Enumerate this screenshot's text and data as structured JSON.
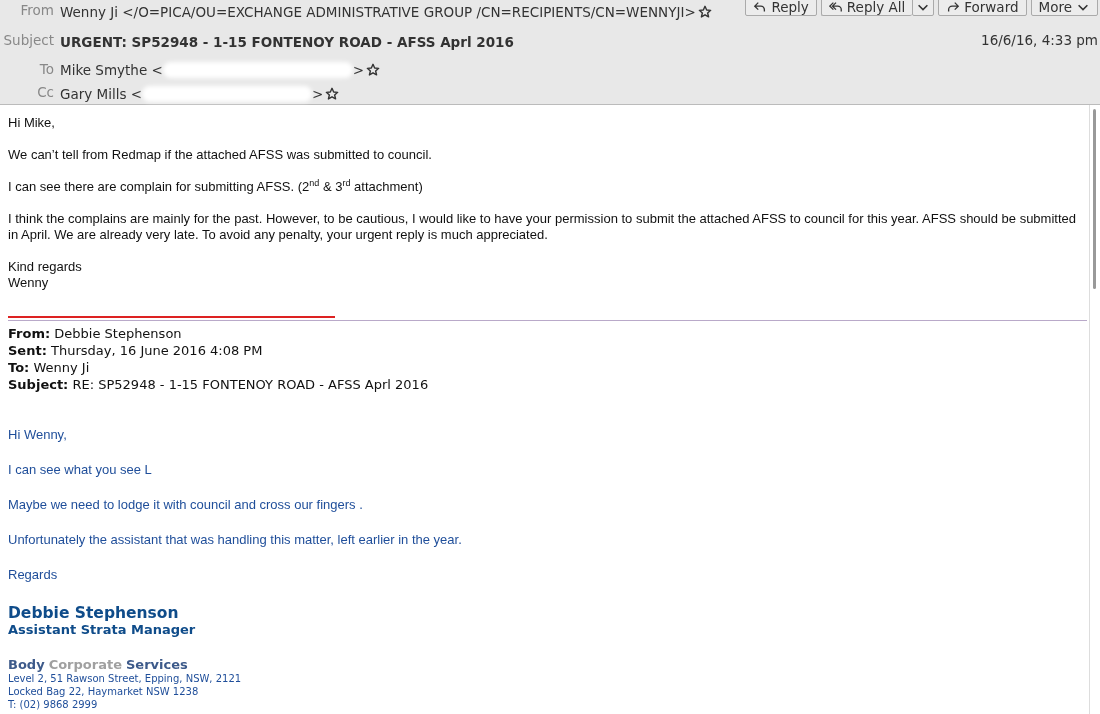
{
  "header": {
    "from": {
      "label": "From",
      "value": "Wenny Ji </O=PICA/OU=EXCHANGE ADMINISTRATIVE GROUP /CN=RECIPIENTS/CN=WENNYJI>",
      "starred": false
    },
    "subject": {
      "label": "Subject",
      "value": "URGENT: SP52948 - 1-15 FONTENOY ROAD - AFSS Aprl 2016"
    },
    "date": "16/6/16, 4:33 pm",
    "recipients": [
      {
        "label": "To",
        "before": "Mike Smythe <",
        "after": ">",
        "starred": false
      },
      {
        "label": "Cc",
        "before": "Gary Mills <",
        "after": ">",
        "starred": false
      }
    ],
    "buttons": [
      {
        "kind": "reply",
        "label": "Reply"
      },
      {
        "kind": "reply-all",
        "label": "Reply All"
      },
      {
        "kind": "dropdown"
      },
      {
        "kind": "forward",
        "label": "Forward"
      },
      {
        "kind": "more",
        "label": "More"
      }
    ]
  },
  "message": {
    "paragraphs": [
      [
        "Hi Mike,"
      ],
      [
        "We can’t tell from Redmap if the attached AFSS was submitted to council."
      ],
      [
        "I can see there are complain for submitting AFSS. (2$^{nd}$ & 3$^{rd}$ attachment)"
      ],
      [
        "I think the complains are mainly for the past. However, to be cautious, I would like to have your permission to submit the attached AFSS to council for this year. AFSS should be submitted in April. We are already very late. To avoid any penalty, your urgent reply is much appreciated."
      ],
      [
        "Kind regards",
        "Wenny"
      ]
    ]
  },
  "quoted": {
    "fields": [
      {
        "label": "From:",
        "value": "Debbie Stephenson"
      },
      {
        "label": "Sent:",
        "value": "Thursday, 16 June 2016 4:08 PM"
      },
      {
        "label": "To:",
        "value": "Wenny Ji"
      },
      {
        "label": "Subject:",
        "value": "RE: SP52948 - 1-15 FONTENOY ROAD - AFSS Aprl 2016"
      }
    ],
    "paragraphs": [
      "Hi Wenny,",
      "I can see what you see L",
      "Maybe we need to lodge it with council and cross our fingers .",
      "Unfortunately the assistant that was handling this matter, left earlier in the year.",
      "Regards"
    ],
    "signature": {
      "name": "Debbie Stephenson",
      "title": "Assistant Strata Manager",
      "company": [
        {
          "text": "Body",
          "color": "#3d5a8a"
        },
        {
          "text": "Corporate",
          "color": "#a0a0a0"
        },
        {
          "text": "Services",
          "color": "#3d5a8a"
        }
      ],
      "lines": [
        "Level 2, 51 Rawson Street, Epping, NSW, 2121",
        "Locked Bag 22, Haymarket NSW 1238",
        "T: (02) 9868 2999"
      ]
    }
  }
}
